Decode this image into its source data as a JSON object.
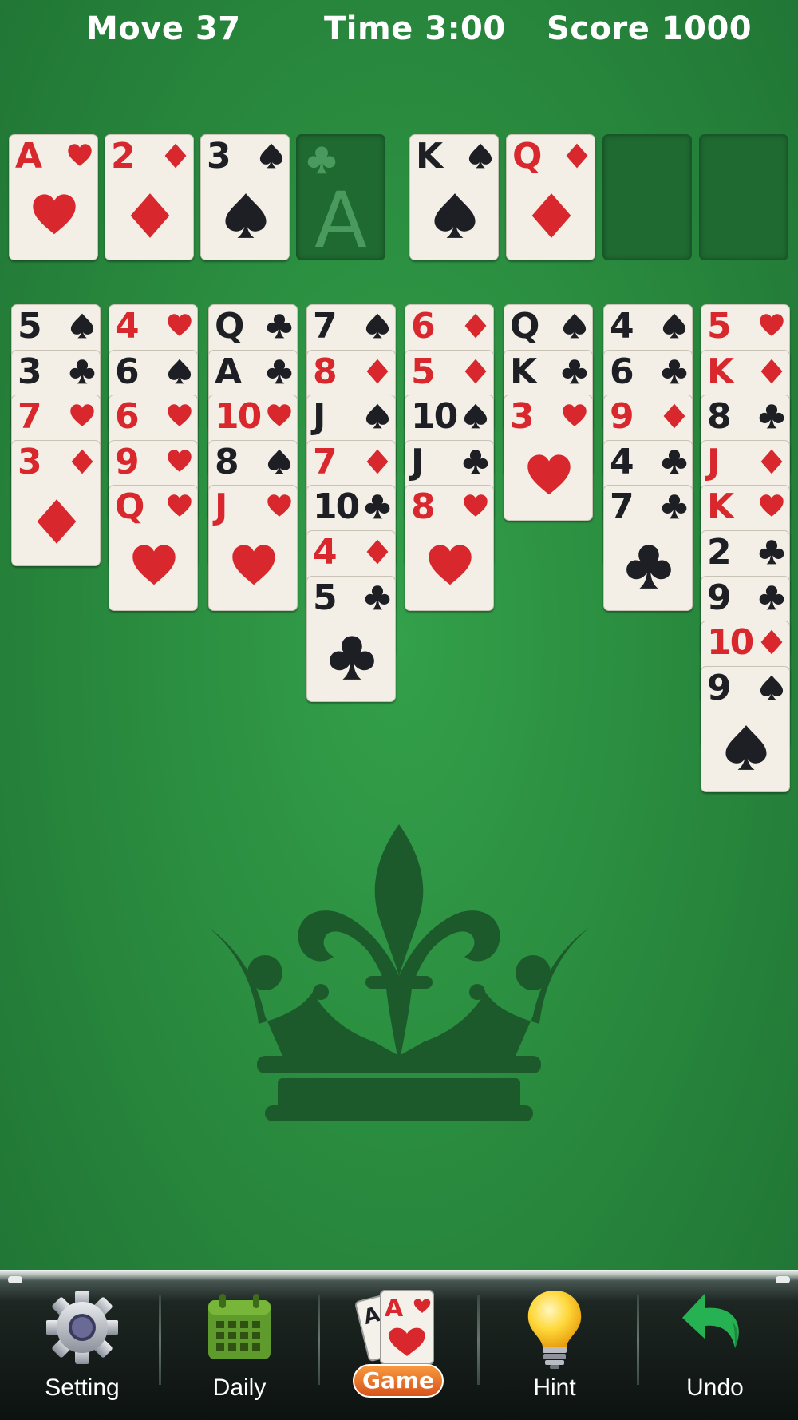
{
  "hud": {
    "move": "Move  37",
    "time": "Time 3:00",
    "score": "Score 1000"
  },
  "colors": {
    "felt": "#2a8c3f",
    "red_suit": "#d9272e",
    "black_suit": "#1d1f24",
    "card": "#f3efe6"
  },
  "foundation_ghost": {
    "rank": "A",
    "suit": "club"
  },
  "top_row": [
    {
      "rank": "A",
      "suit": "heart"
    },
    {
      "rank": "2",
      "suit": "diamond"
    },
    {
      "rank": "3",
      "suit": "spade"
    },
    {
      "empty": true,
      "ghost": true
    },
    {
      "rank": "K",
      "suit": "spade"
    },
    {
      "rank": "Q",
      "suit": "diamond"
    },
    {
      "empty": true
    },
    {
      "empty": true
    }
  ],
  "tableau": [
    [
      {
        "rank": "5",
        "suit": "spade"
      },
      {
        "rank": "3",
        "suit": "club"
      },
      {
        "rank": "7",
        "suit": "heart"
      },
      {
        "rank": "3",
        "suit": "diamond"
      }
    ],
    [
      {
        "rank": "4",
        "suit": "heart"
      },
      {
        "rank": "6",
        "suit": "spade"
      },
      {
        "rank": "6",
        "suit": "heart"
      },
      {
        "rank": "9",
        "suit": "heart"
      },
      {
        "rank": "Q",
        "suit": "heart"
      }
    ],
    [
      {
        "rank": "Q",
        "suit": "club"
      },
      {
        "rank": "A",
        "suit": "club"
      },
      {
        "rank": "10",
        "suit": "heart"
      },
      {
        "rank": "8",
        "suit": "spade"
      },
      {
        "rank": "J",
        "suit": "heart"
      }
    ],
    [
      {
        "rank": "7",
        "suit": "spade"
      },
      {
        "rank": "8",
        "suit": "diamond"
      },
      {
        "rank": "J",
        "suit": "spade"
      },
      {
        "rank": "7",
        "suit": "diamond"
      },
      {
        "rank": "10",
        "suit": "club"
      },
      {
        "rank": "4",
        "suit": "diamond"
      },
      {
        "rank": "5",
        "suit": "club"
      }
    ],
    [
      {
        "rank": "6",
        "suit": "diamond"
      },
      {
        "rank": "5",
        "suit": "diamond"
      },
      {
        "rank": "10",
        "suit": "spade"
      },
      {
        "rank": "J",
        "suit": "club"
      },
      {
        "rank": "8",
        "suit": "heart"
      }
    ],
    [
      {
        "rank": "Q",
        "suit": "spade"
      },
      {
        "rank": "K",
        "suit": "club"
      },
      {
        "rank": "3",
        "suit": "heart"
      }
    ],
    [
      {
        "rank": "4",
        "suit": "spade"
      },
      {
        "rank": "6",
        "suit": "club"
      },
      {
        "rank": "9",
        "suit": "diamond"
      },
      {
        "rank": "4",
        "suit": "club"
      },
      {
        "rank": "7",
        "suit": "club"
      }
    ],
    [
      {
        "rank": "5",
        "suit": "heart"
      },
      {
        "rank": "K",
        "suit": "diamond"
      },
      {
        "rank": "8",
        "suit": "club"
      },
      {
        "rank": "J",
        "suit": "diamond"
      },
      {
        "rank": "K",
        "suit": "heart"
      },
      {
        "rank": "2",
        "suit": "club"
      },
      {
        "rank": "9",
        "suit": "club"
      },
      {
        "rank": "10",
        "suit": "diamond"
      },
      {
        "rank": "9",
        "suit": "spade"
      }
    ]
  ],
  "crown_emblem": "crown-fleur-de-lis",
  "bottom_nav": {
    "setting": {
      "label": "Setting",
      "icon": "gear-icon"
    },
    "daily": {
      "label": "Daily",
      "icon": "calendar-icon"
    },
    "game": {
      "label": "Game",
      "icon": "cards-icon"
    },
    "hint": {
      "label": "Hint",
      "icon": "lightbulb-icon"
    },
    "undo": {
      "label": "Undo",
      "icon": "undo-arrow-icon"
    }
  }
}
